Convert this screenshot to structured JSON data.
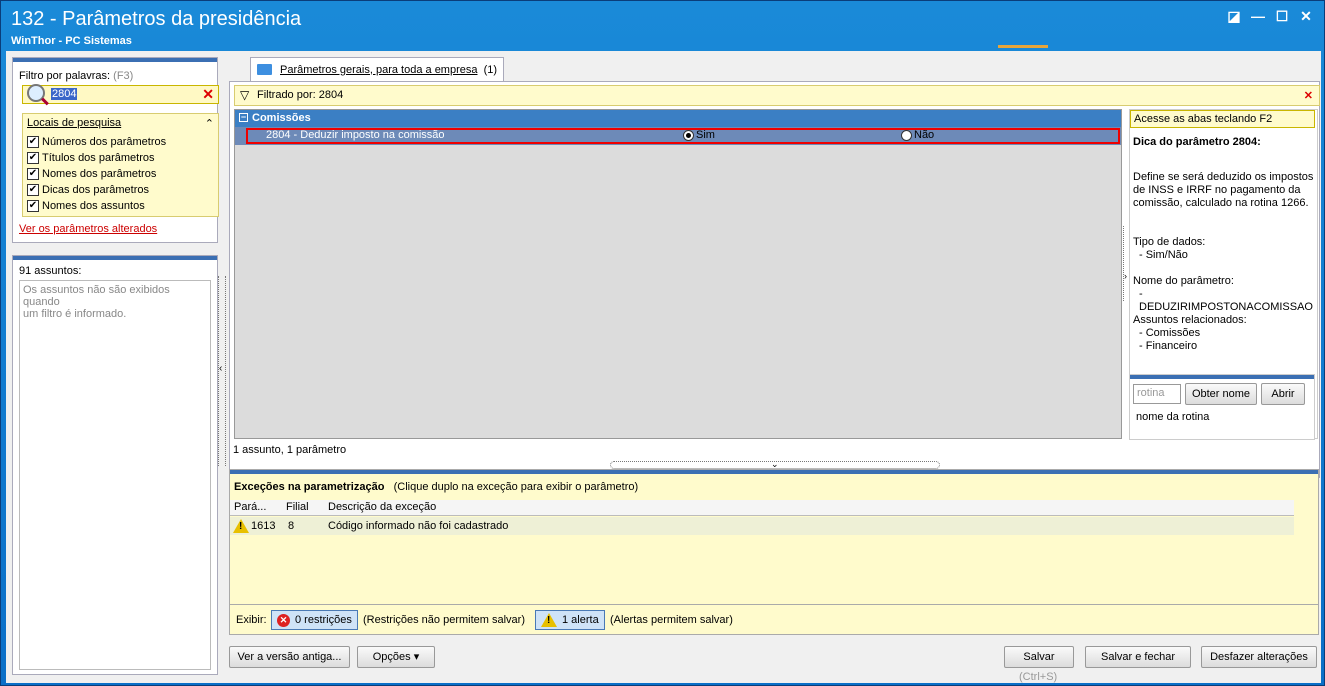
{
  "window": {
    "title": "132 - Parâmetros da presidência",
    "subtitle": "WinThor - PC Sistemas",
    "controls": [
      "◪",
      "—",
      "☐",
      "✕"
    ]
  },
  "filter_panel": {
    "label": "Filtro por palavras:",
    "shortcut": "(F3)",
    "value": "2804",
    "locais_title": "Locais de pesquisa",
    "options": [
      {
        "label": "Números dos parâmetros",
        "checked": true
      },
      {
        "label": "Títulos dos parâmetros",
        "checked": true
      },
      {
        "label": "Nomes dos parâmetros",
        "checked": true
      },
      {
        "label": "Dicas dos parâmetros",
        "checked": true
      },
      {
        "label": "Nomes dos assuntos",
        "checked": true
      }
    ],
    "link": "Ver os parâmetros alterados"
  },
  "assuntos_panel": {
    "count": "91 assuntos:",
    "message_line1": "Os assuntos não são exibidos quando",
    "message_line2": "um filtro é informado."
  },
  "tab": {
    "label": "Parâmetros gerais, para toda a empresa",
    "count": "(1)"
  },
  "filter_bar": {
    "text": "Filtrado por: 2804"
  },
  "grid": {
    "group": "Comissões",
    "row_label": "2804 - Deduzir imposto na comissão",
    "option_yes": "Sim",
    "option_no": "Não",
    "selected": "Sim",
    "footer": "1 assunto, 1 parâmetro"
  },
  "dica": {
    "hint": "Acesse as abas teclando F2",
    "title": "Dica do parâmetro 2804:",
    "desc_line1": "Define se será deduzido os impostos",
    "desc_line2": "de INSS e IRRF no pagamento da",
    "desc_line3": "comissão, calculado na rotina 1266.",
    "tipo_label": "Tipo de dados:",
    "tipo_value": "- Sim/Não",
    "nome_label": "Nome do parâmetro:",
    "nome_value": "- DEDUZIRIMPOSTONACOMISSAO",
    "assuntos_label": "Assuntos relacionados:",
    "assunto1": "- Comissões",
    "assunto2": "- Financeiro"
  },
  "rotina": {
    "placeholder": "rotina",
    "obter": "Obter nome",
    "abrir": "Abrir",
    "nome": "nome da rotina"
  },
  "excecoes": {
    "title": "Exceções na parametrização",
    "subtitle": "(Clique duplo na exceção para exibir o parâmetro)",
    "columns": [
      "Pará...",
      "Filial",
      "Descrição da exceção"
    ],
    "rows": [
      {
        "param": "1613",
        "filial": "8",
        "desc": "Código informado não foi cadastrado"
      }
    ]
  },
  "exibir": {
    "label": "Exibir:",
    "restricoes": "0 restrições",
    "restricoes_note": "(Restrições não permitem salvar)",
    "alertas": "1 alerta",
    "alertas_note": "(Alertas permitem salvar)"
  },
  "bottom": {
    "versao": "Ver a versão antiga...",
    "opcoes": "Opções",
    "salvar": "Salvar",
    "salvar_hint": "(Ctrl+S)",
    "salvar_fechar": "Salvar e fechar",
    "desfazer": "Desfazer alterações"
  }
}
